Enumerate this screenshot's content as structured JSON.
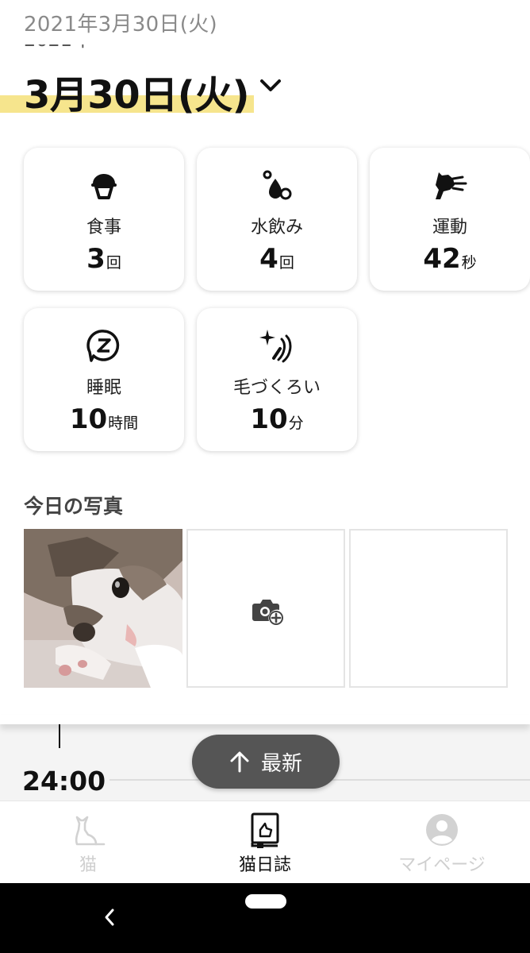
{
  "header": {
    "top_date": "2021年3月30日(火)",
    "year_peek": "2021年",
    "big_date": "3月30日(火)"
  },
  "stats": [
    {
      "label": "食事",
      "value": "3",
      "unit": "回",
      "icon": "food-bowl-icon"
    },
    {
      "label": "水飲み",
      "value": "4",
      "unit": "回",
      "icon": "water-drops-icon"
    },
    {
      "label": "運動",
      "value": "42",
      "unit": "秒",
      "icon": "running-cat-icon"
    },
    {
      "label": "睡眠",
      "value": "10",
      "unit": "時間",
      "icon": "sleep-z-icon"
    },
    {
      "label": "毛づくろい",
      "value": "10",
      "unit": "分",
      "icon": "grooming-sparkle-icon"
    }
  ],
  "photos": {
    "title": "今日の写真",
    "add_icon": "add-photo-camera-icon"
  },
  "timeline": {
    "time": "24:00",
    "latest_button": "最新"
  },
  "bottom_nav": [
    {
      "label": "猫",
      "icon": "cat-icon",
      "active": false
    },
    {
      "label": "猫日誌",
      "icon": "diary-icon",
      "active": true
    },
    {
      "label": "マイページ",
      "icon": "user-avatar-icon",
      "active": false
    }
  ],
  "colors": {
    "accent_highlight": "#f6e58d",
    "button_dark": "#555555",
    "inactive": "#cfcfcf"
  }
}
